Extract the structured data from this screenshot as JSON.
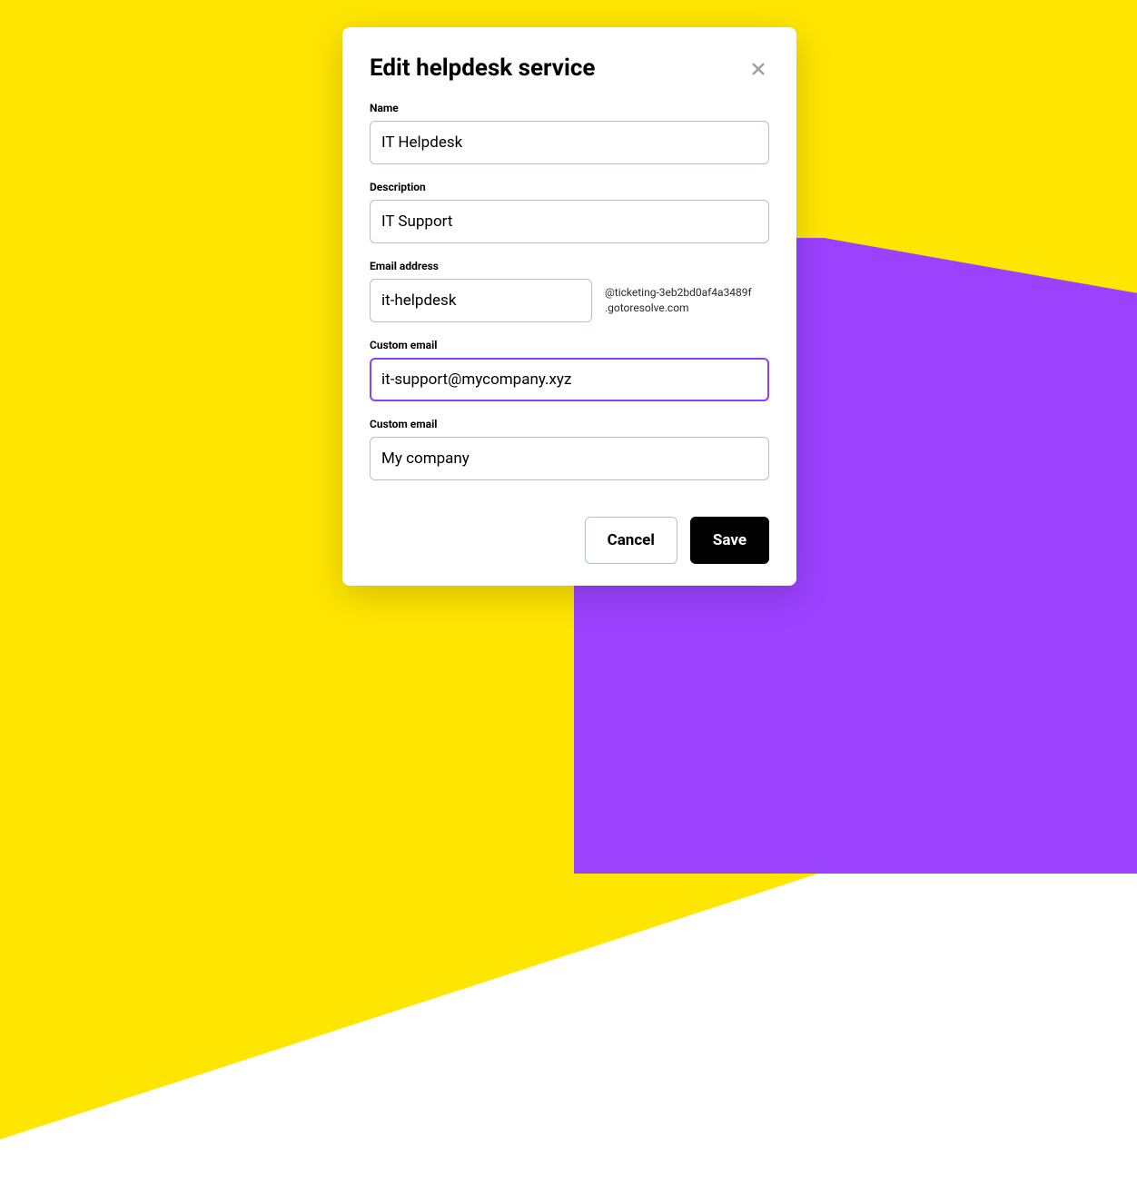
{
  "modal": {
    "title": "Edit helpdesk service",
    "fields": {
      "name": {
        "label": "Name",
        "value": "IT Helpdesk"
      },
      "description": {
        "label": "Description",
        "value": "IT Support"
      },
      "email": {
        "label": "Email address",
        "value": "it-helpdesk",
        "suffix_line1": "@ticketing-3eb2bd0af4a3489f",
        "suffix_line2": ".gotoresolve.com"
      },
      "custom_email": {
        "label": "Custom email",
        "value": "it-support@mycompany.xyz"
      },
      "custom_email2": {
        "label": "Custom email",
        "value": "My company"
      }
    },
    "actions": {
      "cancel": "Cancel",
      "save": "Save"
    }
  }
}
